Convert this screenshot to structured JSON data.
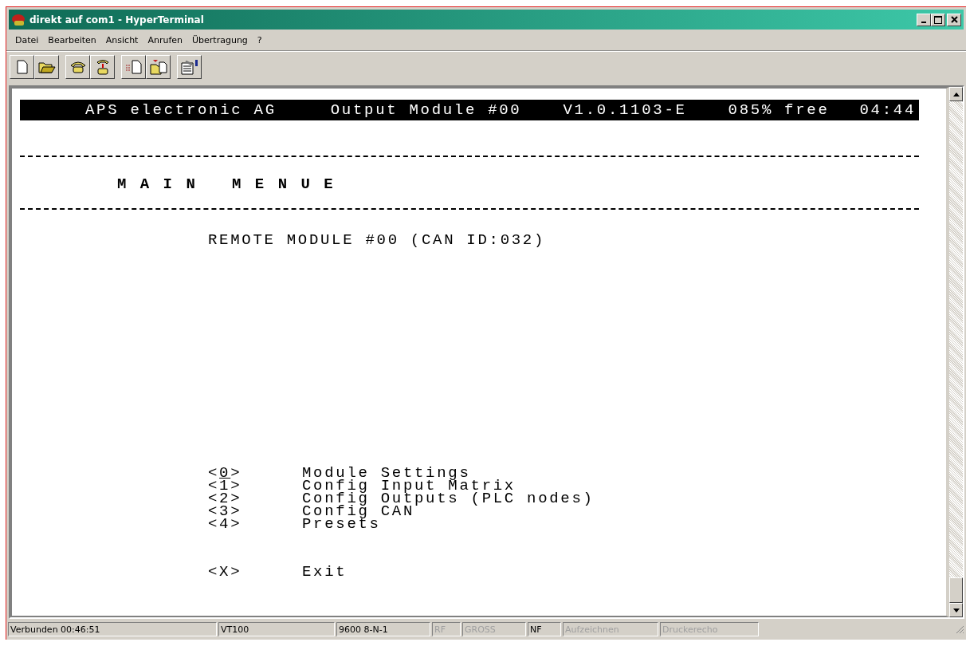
{
  "window": {
    "title": "direkt auf com1 - HyperTerminal"
  },
  "menu": [
    "Datei",
    "Bearbeiten",
    "Ansicht",
    "Anrufen",
    "Übertragung",
    "?"
  ],
  "terminal": {
    "header": [
      "APS electronic AG",
      "Output Module #00",
      "V1.0.1103-E",
      "085% free",
      "04:44"
    ],
    "title": "M A I N   M E N U E",
    "subtitle": "REMOTE MODULE #00 (CAN ID:032)",
    "items": [
      {
        "key": "<0>",
        "label": "Module Settings",
        "cursor": true
      },
      {
        "key": "<1>",
        "label": "Config Input Matrix",
        "cursor": false
      },
      {
        "key": "<2>",
        "label": "Config Outputs (PLC nodes)",
        "cursor": false
      },
      {
        "key": "<3>",
        "label": "Config CAN",
        "cursor": false
      },
      {
        "key": "<4>",
        "label": "Presets",
        "cursor": false
      }
    ],
    "exit": {
      "key": "<X>",
      "label": "Exit"
    }
  },
  "status_bar": [
    {
      "text": "Verbunden 00:46:51",
      "disabled": false
    },
    {
      "text": "VT100",
      "disabled": false
    },
    {
      "text": "9600 8-N-1",
      "disabled": false
    },
    {
      "text": "RF",
      "disabled": true
    },
    {
      "text": "GROSS",
      "disabled": true
    },
    {
      "text": "NF",
      "disabled": false
    },
    {
      "text": "Aufzeichnen",
      "disabled": true
    },
    {
      "text": "Druckerecho",
      "disabled": true
    }
  ]
}
